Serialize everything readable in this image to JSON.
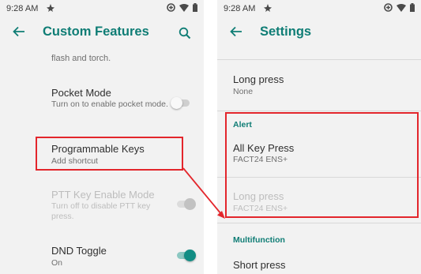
{
  "left": {
    "status": {
      "time": "9:28 AM"
    },
    "title": "Custom Features",
    "partial_text": "flash and torch.",
    "items": [
      {
        "title": "Pocket Mode",
        "subtitle": "Turn on to enable pocket mode.",
        "toggle": "off"
      },
      {
        "title": "Programmable Keys",
        "subtitle": "Add shortcut"
      },
      {
        "title": "PTT Key Enable Mode",
        "subtitle": "Turn off to disable PTT key press.",
        "toggle": "disabled-on"
      },
      {
        "title": "DND Toggle",
        "subtitle": "On",
        "toggle": "on"
      }
    ]
  },
  "right": {
    "status": {
      "time": "9:28 AM"
    },
    "title": "Settings",
    "items": [
      {
        "title": "Long press",
        "subtitle": "None"
      },
      {
        "category": "Alert"
      },
      {
        "title": "All Key Press",
        "subtitle": "FACT24 ENS+"
      },
      {
        "title": "Long press",
        "subtitle": "FACT24 ENS+"
      },
      {
        "category": "Multifunction"
      },
      {
        "title": "Short press"
      }
    ]
  },
  "colors": {
    "accent": "#0f7d75",
    "highlight": "#e3262c",
    "background": "#f2f2f2"
  }
}
